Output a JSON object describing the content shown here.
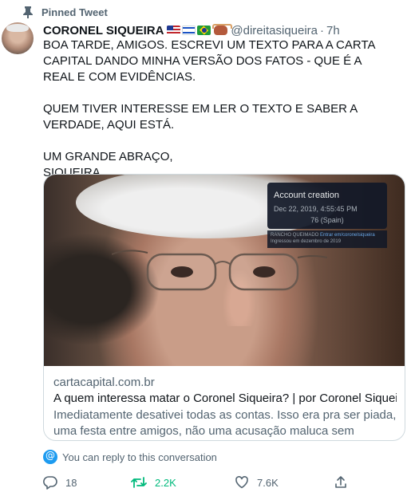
{
  "pinned": {
    "label": "Pinned Tweet"
  },
  "author": {
    "name": "CORONEL SIQUEIRA",
    "emoji_icons": [
      "us-flag-icon",
      "israel-flag-icon",
      "brazil-flag-icon",
      "ox-icon"
    ],
    "handle": "@direitasiqueira",
    "separator": "·",
    "time": "7h"
  },
  "tweet": {
    "text": "BOA TARDE, AMIGOS. ESCREVI UM TEXTO PARA A CARTA CAPITAL DANDO MINHA VERSÃO DOS FATOS - QUE É A REAL E COM EVIDÊNCIAS.\n\nQUEM TIVER INTERESSE EM LER O TEXTO E SABER A VERDADE, AQUI ESTÁ.\n\nUM GRANDE ABRAÇO,\nSIQUEIRA."
  },
  "card": {
    "image_overlay": {
      "title": "Account creation",
      "date": "Dec 22, 2019, 4:55:45 PM",
      "count": "76 (Spain)",
      "sub_left": "RANCHO QUEIMADO",
      "sub_link": "Entrar em/coronelsiqueira",
      "sub_bottom": "Ingressou em dezembro de 2019"
    },
    "domain": "cartacapital.com.br",
    "title": "A quem interessa matar o Coronel Siqueira? | por Coronel Siqueira",
    "description": "Imediatamente desativei todas as contas. Isso era pra ser piada, uma festa entre amigos, não uma acusação maluca sem nenhum tipo de …"
  },
  "reply_notice": {
    "text": "You can reply to this conversation"
  },
  "actions": {
    "reply_count": "18",
    "retweet_count": "2.2K",
    "like_count": "7.6K"
  },
  "colors": {
    "accent": "#1d9bf0",
    "retweet": "#00ba7c",
    "secondary_text": "#536471"
  }
}
